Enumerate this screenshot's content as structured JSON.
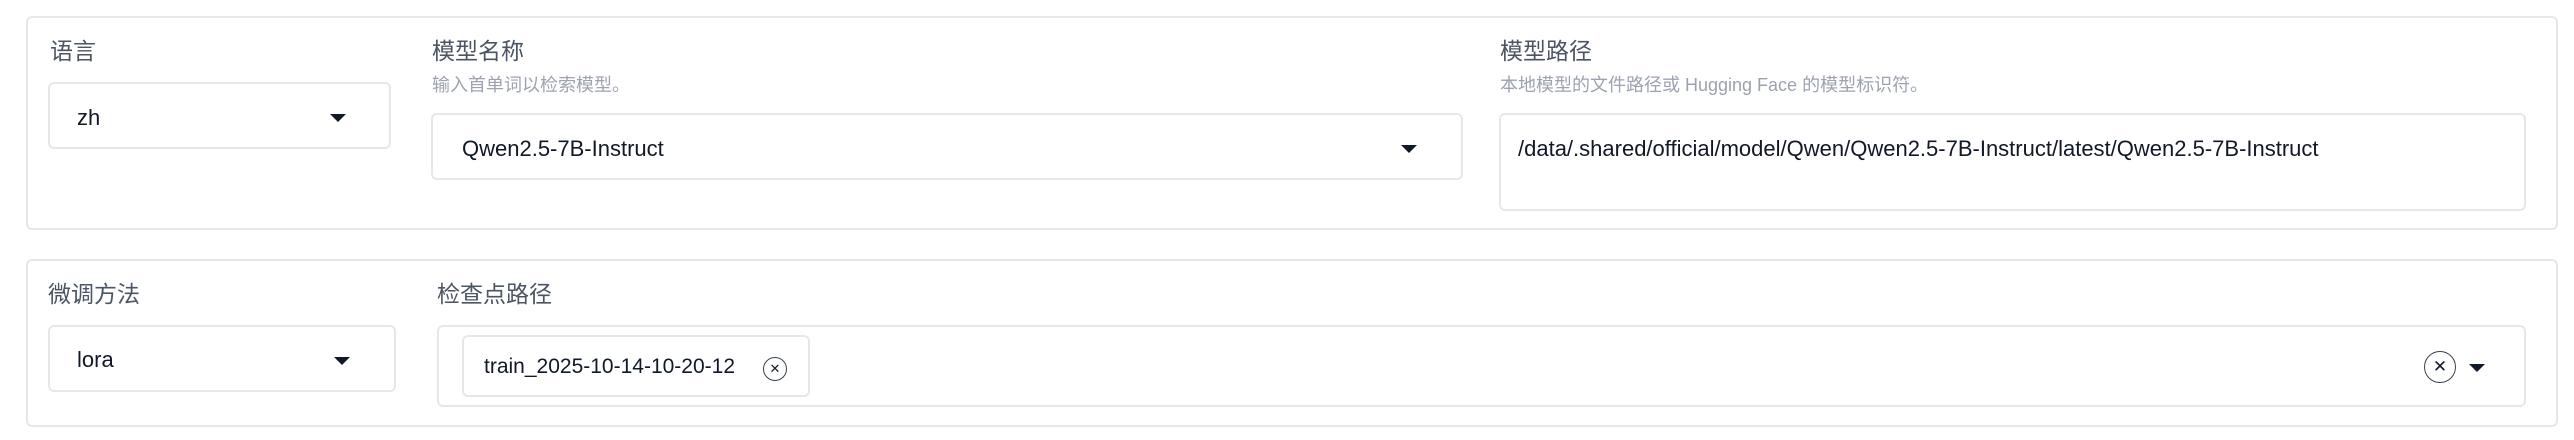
{
  "language": {
    "label": "语言",
    "value": "zh"
  },
  "model_name": {
    "label": "模型名称",
    "info": "输入首单词以检索模型。",
    "value": "Qwen2.5-7B-Instruct"
  },
  "model_path": {
    "label": "模型路径",
    "info": "本地模型的文件路径或 Hugging Face 的模型标识符。",
    "value": "/data/.shared/official/model/Qwen/Qwen2.5-7B-Instruct/latest/Qwen2.5-7B-Instruct"
  },
  "finetune_method": {
    "label": "微调方法",
    "value": "lora"
  },
  "checkpoint_path": {
    "label": "检查点路径",
    "selected": [
      "train_2025-10-14-10-20-12"
    ]
  },
  "icons": {
    "dropdown": "chevron-down-icon",
    "remove": "close-icon",
    "clear": "clear-icon"
  }
}
